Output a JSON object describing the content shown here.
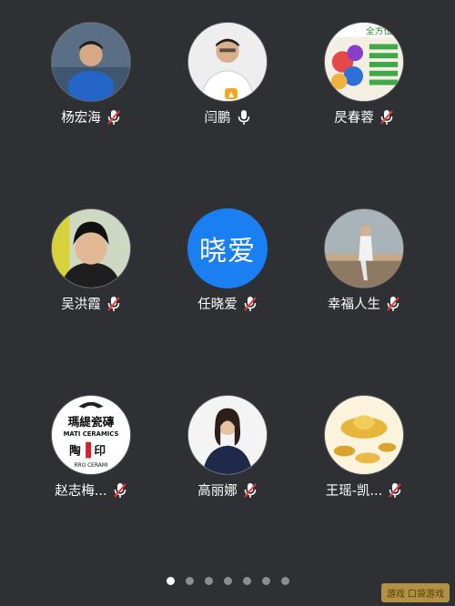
{
  "participants": [
    {
      "name": "杨宏海",
      "mic": "muted"
    },
    {
      "name": "闫鹏",
      "mic": "on"
    },
    {
      "name": "昃春蓉",
      "mic": "muted"
    },
    {
      "name": "吴洪霞",
      "mic": "muted"
    },
    {
      "name": "任晓爱",
      "mic": "muted",
      "avatar_text": "晓爱"
    },
    {
      "name": "幸福人生",
      "mic": "muted"
    },
    {
      "name": "赵志梅...",
      "mic": "muted"
    },
    {
      "name": "高丽娜",
      "mic": "muted"
    },
    {
      "name": "王瑶-凯...",
      "mic": "muted"
    }
  ],
  "logo_card": {
    "line1": "瑪緹瓷磚",
    "line2": "MATI CERAMICS",
    "line3": "陶",
    "line4": "印",
    "line5": "RRO CERAMI"
  },
  "ad_card": {
    "headline": "全方位营"
  },
  "pager": {
    "pages": 7,
    "active": 0
  },
  "watermark": "游戏 口袋游戏",
  "colors": {
    "background": "#2e3033",
    "accent": "#1a7ff1",
    "muted_red": "#e63b3b"
  }
}
